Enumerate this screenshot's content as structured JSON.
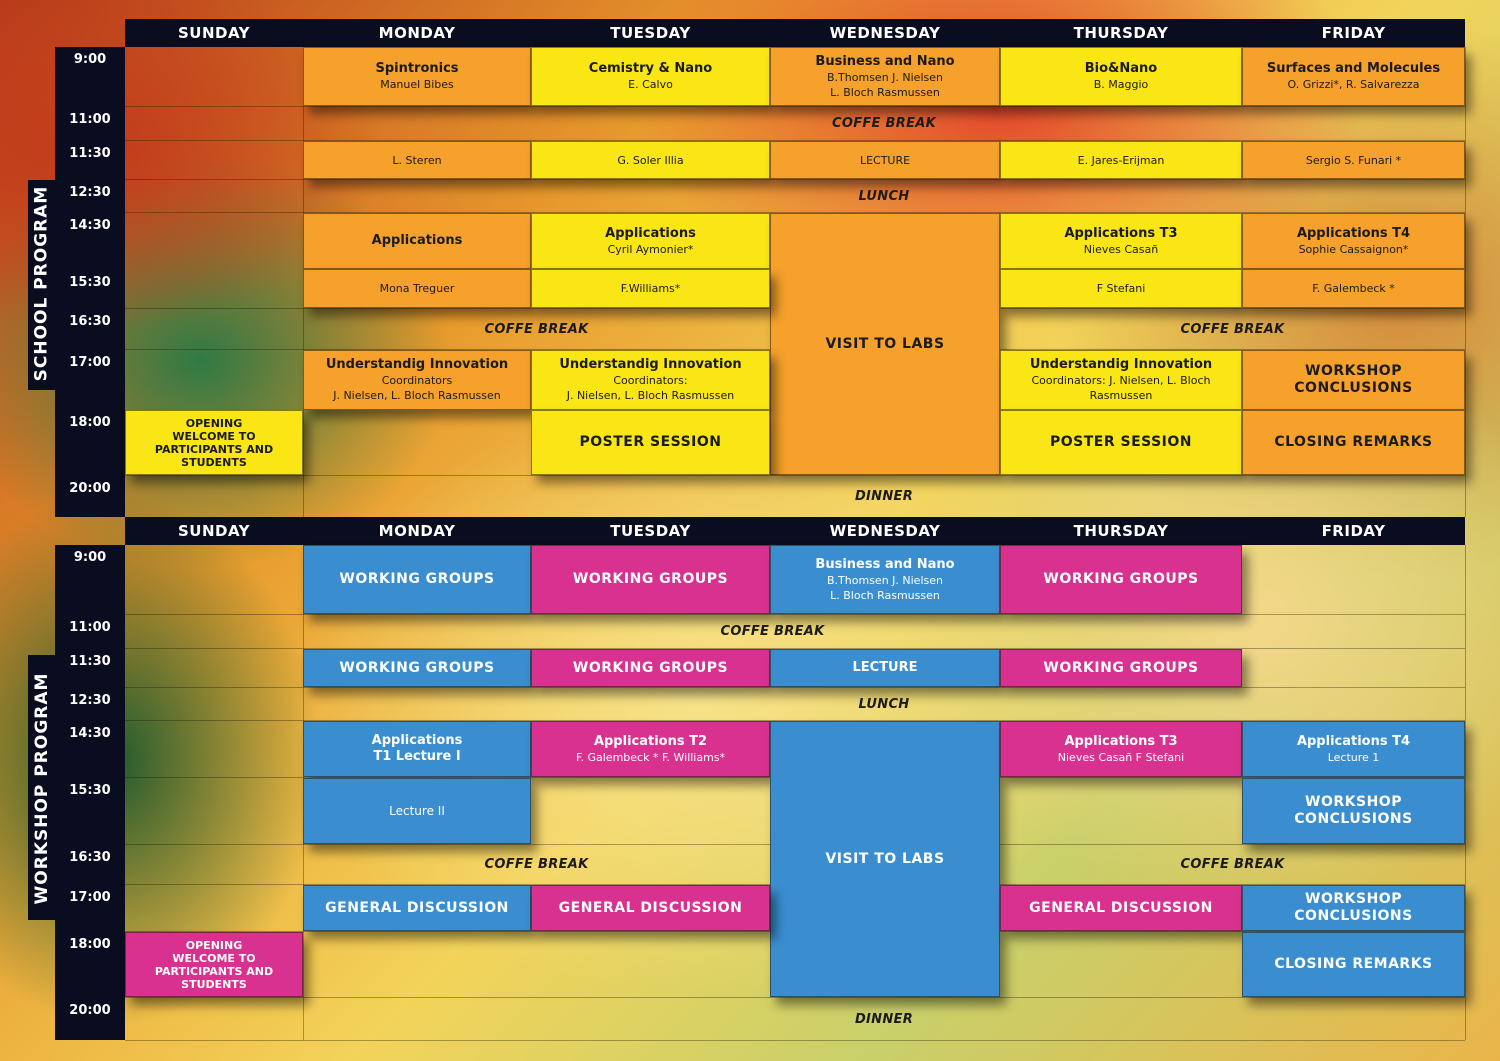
{
  "days": [
    "SUNDAY",
    "MONDAY",
    "TUESDAY",
    "WEDNESDAY",
    "THURSDAY",
    "FRIDAY"
  ],
  "times": [
    "9:00",
    "11:00",
    "11:30",
    "12:30",
    "14:30",
    "15:30",
    "16:30",
    "17:00",
    "18:00",
    "20:00"
  ],
  "school": {
    "label": "SCHOOL PROGRAM",
    "mon_9": {
      "title": "Spintronics",
      "sub": "Manuel Bibes"
    },
    "tue_9": {
      "title": "Cemistry & Nano",
      "sub": "E. Calvo"
    },
    "wed_9": {
      "title": "Business and Nano",
      "sub1": "B.Thomsen J.  Nielsen",
      "sub2": "L. Bloch Rasmussen"
    },
    "thu_9": {
      "title": "Bio&Nano",
      "sub": "B. Maggio"
    },
    "fri_9": {
      "title": "Surfaces and Molecules",
      "sub": "O. Grizzi*, R. Salvarezza"
    },
    "coffee1": "COFFE BREAK",
    "mon_1130": "L. Steren",
    "tue_1130": "G. Soler Illia",
    "wed_1130": "LECTURE",
    "thu_1130": "E. Jares-Erijman",
    "fri_1130": "Sergio S. Funari *",
    "lunch": "LUNCH",
    "mon_1430": "Applications",
    "tue_1430": {
      "title": "Applications",
      "sub": "Cyril Aymonier*"
    },
    "thu_1430": {
      "title": "Applications T3",
      "sub": "Nieves Casañ"
    },
    "fri_1430": {
      "title": "Applications T4",
      "sub": "Sophie Cassaignon*"
    },
    "mon_1530": "Mona Treguer",
    "tue_1530": "F.Williams*",
    "thu_1530": "F Stefani",
    "fri_1530": "F. Galembeck *",
    "visit": "VISIT TO LABS",
    "coffee2": "COFFE BREAK",
    "coffee3": "COFFE BREAK",
    "mon_17": {
      "title": "Understandig Innovation",
      "sub1": "Coordinators",
      "sub2": "J.  Nielsen, L. Bloch Rasmussen"
    },
    "tue_17": {
      "title": "Understandig Innovation",
      "sub1": "Coordinators:",
      "sub2": "J.  Nielsen, L. Bloch Rasmussen"
    },
    "thu_17": {
      "title": "Understandig Innovation",
      "sub1": "Coordinators: J.  Nielsen, L. Bloch",
      "sub2": "Rasmussen"
    },
    "fri_17": {
      "l1": "WORKSHOP",
      "l2": "CONCLUSIONS"
    },
    "sun_18": {
      "l1": "OPENING",
      "l2": "WELCOME TO",
      "l3": "PARTICIPANTS AND",
      "l4": "STUDENTS"
    },
    "tue_18": "POSTER SESSION",
    "thu_18": "POSTER SESSION",
    "fri_18": "CLOSING REMARKS",
    "dinner": "DINNER"
  },
  "workshop": {
    "label": "WORKSHOP PROGRAM",
    "mon_9": "WORKING GROUPS",
    "tue_9": "WORKING GROUPS",
    "wed_9": {
      "title": "Business and Nano",
      "sub1": "B.Thomsen J.  Nielsen",
      "sub2": "L. Bloch Rasmussen"
    },
    "thu_9": "WORKING GROUPS",
    "coffee1": "COFFE BREAK",
    "mon_1130": "WORKING GROUPS",
    "tue_1130": "WORKING GROUPS",
    "wed_1130": "LECTURE",
    "thu_1130": "WORKING GROUPS",
    "lunch": "LUNCH",
    "mon_1430": {
      "l1": "Applications",
      "l2": "T1 Lecture I"
    },
    "tue_1430": {
      "title": "Applications T2",
      "sub": "F. Galembeck * F. Williams*"
    },
    "thu_1430": {
      "title": "Applications T3",
      "sub": "Nieves Casañ F Stefani"
    },
    "fri_1430": {
      "title": "Applications T4",
      "sub": "Lecture 1"
    },
    "mon_1530": "Lecture II",
    "fri_1530": {
      "l1": "WORKSHOP",
      "l2": "CONCLUSIONS"
    },
    "visit": "VISIT TO LABS",
    "coffee2": "COFFE BREAK",
    "coffee3": "COFFE BREAK",
    "mon_17": "GENERAL DISCUSSION",
    "tue_17": "GENERAL DISCUSSION",
    "thu_17": "GENERAL DISCUSSION",
    "fri_17": {
      "l1": "WORKSHOP",
      "l2": "CONCLUSIONS"
    },
    "sun_18": {
      "l1": "OPENING",
      "l2": "WELCOME TO",
      "l3": "PARTICIPANTS AND",
      "l4": "STUDENTS"
    },
    "fri_18": "CLOSING REMARKS",
    "dinner": "DINNER"
  },
  "colors": {
    "orange": "#f5a12b",
    "yellow": "#f9e614",
    "blue": "#3a8ed0",
    "pink": "#d9318f",
    "navy": "#0a0d20"
  }
}
